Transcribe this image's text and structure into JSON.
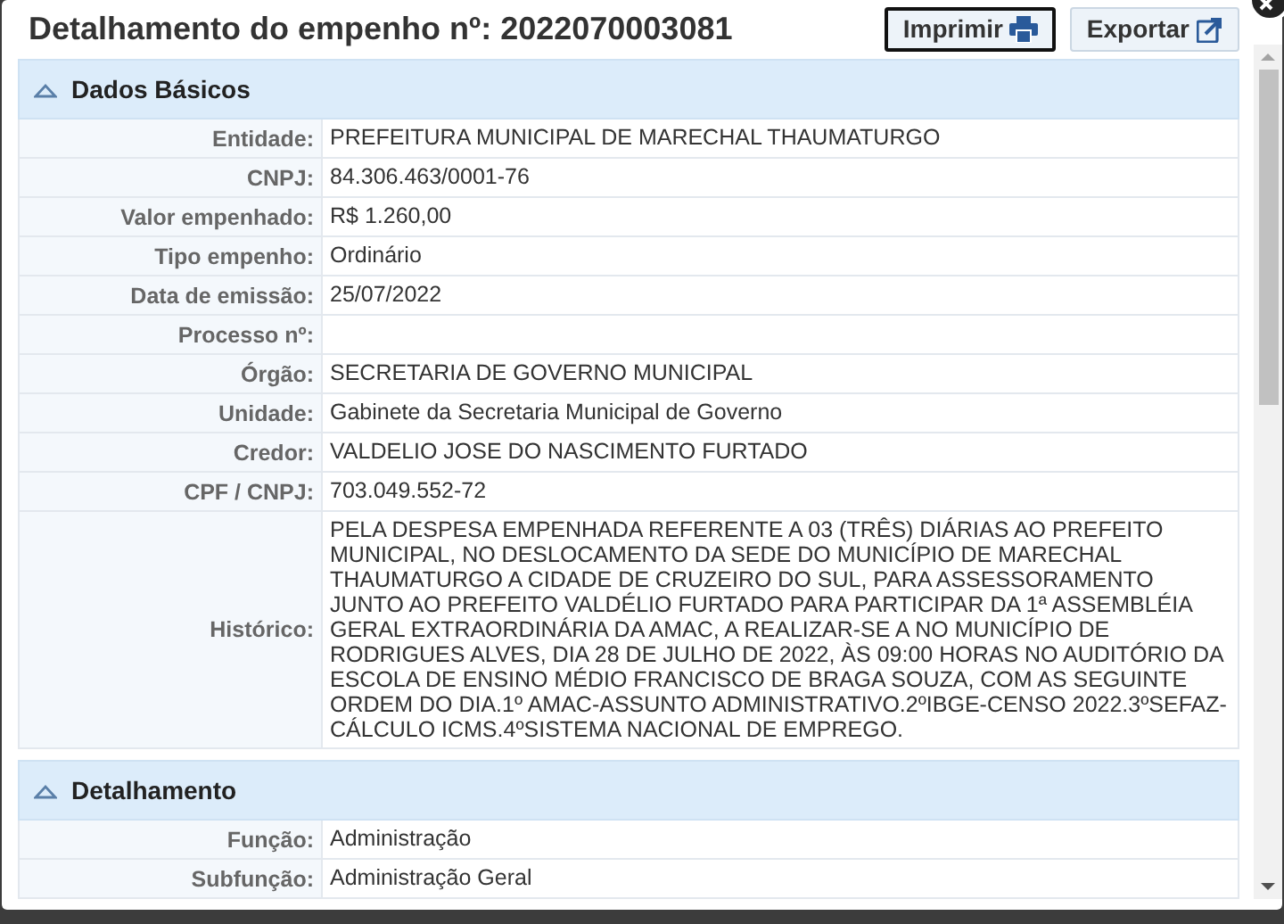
{
  "dialog": {
    "title": "Detalhamento do empenho nº: 2022070003081",
    "buttons": [
      {
        "label": "Imprimir",
        "kind": "print",
        "focused": true
      },
      {
        "label": "Exportar",
        "kind": "export",
        "focused": false
      }
    ]
  },
  "sections": [
    {
      "title": "Dados Básicos",
      "expanded": true,
      "rows": [
        {
          "label": "Entidade:",
          "value": "PREFEITURA MUNICIPAL DE MARECHAL THAUMATURGO"
        },
        {
          "label": "CNPJ:",
          "value": "84.306.463/0001-76"
        },
        {
          "label": "Valor empenhado:",
          "value": "R$ 1.260,00"
        },
        {
          "label": "Tipo empenho:",
          "value": "Ordinário"
        },
        {
          "label": "Data de emissão:",
          "value": "25/07/2022"
        },
        {
          "label": "Processo nº:"
        },
        {
          "label": "Órgão:",
          "value": "SECRETARIA DE GOVERNO MUNICIPAL"
        },
        {
          "label": "Unidade:",
          "value": "Gabinete da Secretaria Municipal de Governo"
        },
        {
          "label": "Credor:",
          "value": "VALDELIO JOSE DO NASCIMENTO FURTADO"
        },
        {
          "label": "CPF / CNPJ:",
          "value": "703.049.552-72"
        },
        {
          "label": "Histórico:",
          "value": "PELA DESPESA EMPENHADA REFERENTE A 03 (TRÊS) DIÁRIAS AO PREFEITO MUNICIPAL, NO DESLOCAMENTO DA SEDE DO MUNICÍPIO DE MARECHAL THAUMATURGO A CIDADE DE CRUZEIRO DO SUL, PARA ASSESSORAMENTO JUNTO AO PREFEITO VALDÉLIO FURTADO PARA PARTICIPAR DA 1ª ASSEMBLÉIA GERAL EXTRAORDINÁRIA DA AMAC, A REALIZAR-SE A NO MUNICÍPIO DE RODRIGUES ALVES, DIA 28 DE JULHO DE 2022, ÀS 09:00 HORAS NO AUDITÓRIO DA ESCOLA DE ENSINO MÉDIO FRANCISCO DE BRAGA SOUZA, COM AS SEGUINTE ORDEM DO DIA.1º AMAC-ASSUNTO ADMINISTRATIVO.2ºIBGE-CENSO 2022.3ºSEFAZ-CÁLCULO ICMS.4ºSISTEMA NACIONAL DE EMPREGO."
        }
      ]
    },
    {
      "title": "Detalhamento",
      "expanded": true,
      "rows": [
        {
          "label": "Função:",
          "value": "Administração"
        },
        {
          "label": "Subfunção:",
          "value": "Administração Geral"
        }
      ]
    }
  ]
}
